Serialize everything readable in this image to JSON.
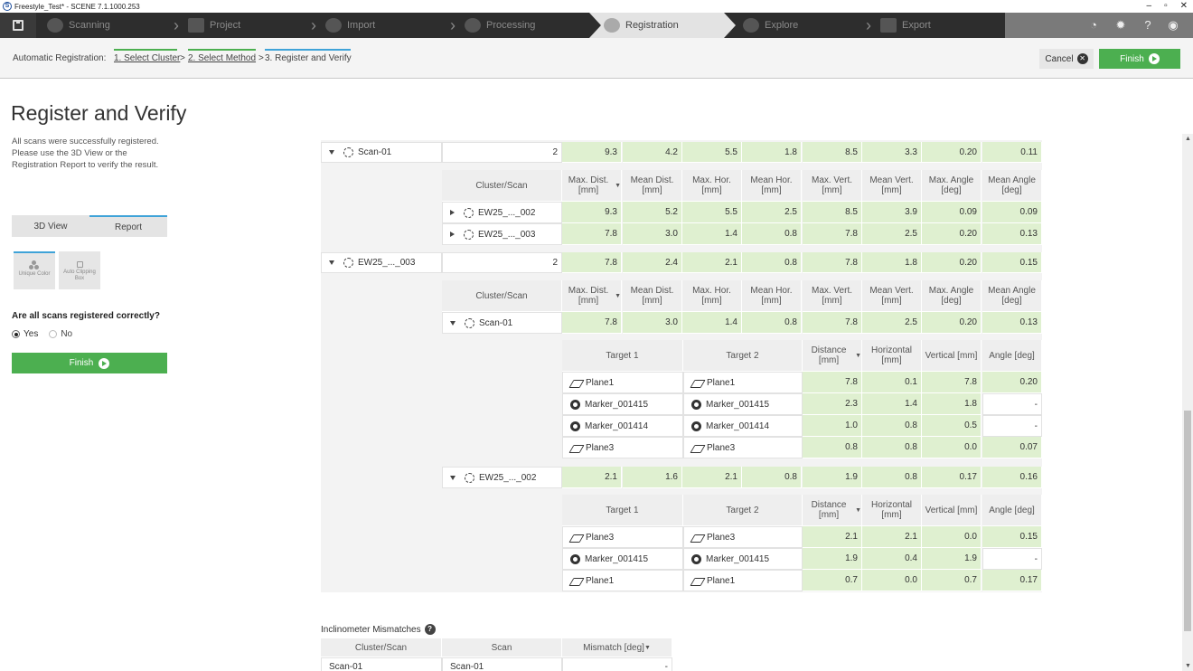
{
  "window": {
    "title": "Freestyle_Test* - SCENE 7.1.1000.253",
    "min": "–",
    "max": "▫",
    "close": "✕"
  },
  "nav": {
    "steps": [
      {
        "label": "Scanning"
      },
      {
        "label": "Project"
      },
      {
        "label": "Import"
      },
      {
        "label": "Processing"
      },
      {
        "label": "Registration"
      },
      {
        "label": "Explore"
      },
      {
        "label": "Export"
      }
    ],
    "active": "Registration"
  },
  "crumbs": {
    "prefix": "Automatic Registration:",
    "step1": "1. Select Cluster",
    "step2": "2. Select Method",
    "step3": "3. Register and Verify",
    "sep": ">"
  },
  "actions": {
    "cancel": "Cancel",
    "finish": "Finish"
  },
  "left": {
    "title": "Register and Verify",
    "description": "All scans were successfully registered. Please use the 3D View or the Registration Report to verify the result.",
    "tabs": [
      "3D View",
      "Report"
    ],
    "options": [
      "Unique Color",
      "Auto Clipping Box"
    ],
    "question": "Are all scans registered correctly?",
    "yes": "Yes",
    "no": "No",
    "finish": "Finish"
  },
  "headers": {
    "cluster": [
      "Cluster/Scan",
      "Max. Dist. [mm]",
      "Mean Dist. [mm]",
      "Max. Hor. [mm]",
      "Mean Hor. [mm]",
      "Max. Vert. [mm]",
      "Mean Vert. [mm]",
      "Max. Angle [deg]",
      "Mean Angle [deg]"
    ],
    "target": [
      "Target 1",
      "Target 2",
      "Distance [mm]",
      "Horizontal [mm]",
      "Vertical [mm]",
      "Angle [deg]"
    ]
  },
  "rows": {
    "scan01": {
      "name": "Scan-01",
      "count": "2",
      "vals": [
        "9.3",
        "4.2",
        "5.5",
        "1.8",
        "8.5",
        "3.3",
        "0.20",
        "0.11"
      ]
    },
    "scan01_children": [
      {
        "name": "EW25_..._002",
        "vals": [
          "9.3",
          "5.2",
          "5.5",
          "2.5",
          "8.5",
          "3.9",
          "0.09",
          "0.09"
        ]
      },
      {
        "name": "EW25_..._003",
        "vals": [
          "7.8",
          "3.0",
          "1.4",
          "0.8",
          "7.8",
          "2.5",
          "0.20",
          "0.13"
        ]
      }
    ],
    "ew003": {
      "name": "EW25_..._003",
      "count": "2",
      "vals": [
        "7.8",
        "2.4",
        "2.1",
        "0.8",
        "7.8",
        "1.8",
        "0.20",
        "0.15"
      ]
    },
    "ew003_scan01": {
      "name": "Scan-01",
      "vals": [
        "7.8",
        "3.0",
        "1.4",
        "0.8",
        "7.8",
        "2.5",
        "0.20",
        "0.13"
      ]
    },
    "targets_a": [
      {
        "t1": "Plane1",
        "t1i": "plane",
        "t2": "Plane1",
        "t2i": "plane",
        "v": [
          "7.8",
          "0.1",
          "7.8",
          "0.20"
        ]
      },
      {
        "t1": "Marker_001415",
        "t1i": "marker",
        "t2": "Marker_001415",
        "t2i": "marker",
        "v": [
          "2.3",
          "1.4",
          "1.8",
          "-"
        ]
      },
      {
        "t1": "Marker_001414",
        "t1i": "marker",
        "t2": "Marker_001414",
        "t2i": "marker",
        "v": [
          "1.0",
          "0.8",
          "0.5",
          "-"
        ]
      },
      {
        "t1": "Plane3",
        "t1i": "plane",
        "t2": "Plane3",
        "t2i": "plane",
        "v": [
          "0.8",
          "0.8",
          "0.0",
          "0.07"
        ]
      }
    ],
    "ew003_ew002": {
      "name": "EW25_..._002",
      "vals": [
        "2.1",
        "1.6",
        "2.1",
        "0.8",
        "1.9",
        "0.8",
        "0.17",
        "0.16"
      ]
    },
    "targets_b": [
      {
        "t1": "Plane3",
        "t1i": "plane",
        "t2": "Plane3",
        "t2i": "plane",
        "v": [
          "2.1",
          "2.1",
          "0.0",
          "0.15"
        ]
      },
      {
        "t1": "Marker_001415",
        "t1i": "marker",
        "t2": "Marker_001415",
        "t2i": "marker",
        "v": [
          "1.9",
          "0.4",
          "1.9",
          "-"
        ]
      },
      {
        "t1": "Plane1",
        "t1i": "plane",
        "t2": "Plane1",
        "t2i": "plane",
        "v": [
          "0.7",
          "0.0",
          "0.7",
          "0.17"
        ]
      }
    ]
  },
  "inclinometer": {
    "label": "Inclinometer Mismatches",
    "headers": [
      "Cluster/Scan",
      "Scan",
      "Mismatch [deg]"
    ],
    "row": [
      "Scan-01",
      "Scan-01",
      "-"
    ]
  },
  "colors": {
    "green": "#4caf50",
    "cellGreen": "#dff0d0",
    "accentBlue": "#3fa3d8"
  }
}
